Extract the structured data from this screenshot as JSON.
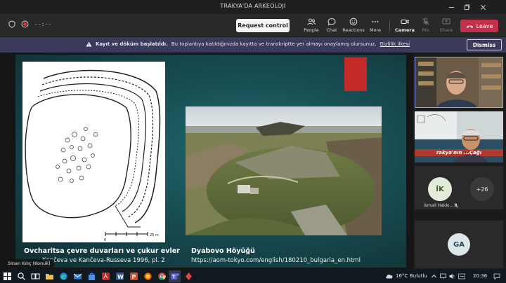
{
  "window": {
    "title": "TRAKYA'DA ARKEOLOJI"
  },
  "toolbar": {
    "timer": "--:--",
    "request_control": "Request control",
    "people": "People",
    "chat": "Chat",
    "reactions": "Reactions",
    "more": "More",
    "camera": "Camera",
    "mic": "Mic",
    "share": "Share",
    "leave": "Leave"
  },
  "banner": {
    "title": "Kayıt ve döküm başlatıldı.",
    "message": "Bu toplantıya katıldığınızda kayıtta ve transkriptte yer almayı onaylamış olursunuz.",
    "link": "Gizlilik ilkesi",
    "dismiss": "Dismiss"
  },
  "slide": {
    "caption_left_title": "Ovcharitsa çevre duvarları ve çukur evler",
    "caption_left_sub": "Kančeva ve Kančeva-Russeva 1996, pl. 2",
    "caption_right_title": "Dyabovo Höyüğü",
    "caption_right_sub": "https://aom-tokyo.com/english/180210_bulgaria_en.html",
    "scale_label": "25 m",
    "scale_zero": "0"
  },
  "presenter": {
    "name": "Sinan Kılıç (Konuk)"
  },
  "participants": {
    "video2_overlay": "rakya'nın ...Çağı",
    "tile1_initials": "İK",
    "tile1_name": "İsmail Hakkı...",
    "overflow": "+26",
    "tile2_initials": "GA"
  },
  "taskbar": {
    "temperature": "16°C",
    "weather": "Bulutlu",
    "time": "20:36"
  },
  "colors": {
    "leave": "#c4314b",
    "banner": "#3b3a5a",
    "accent": "#9ea2ff",
    "avatar_ik": "#e3ecd9",
    "avatar_ga": "#dbe7e8"
  }
}
